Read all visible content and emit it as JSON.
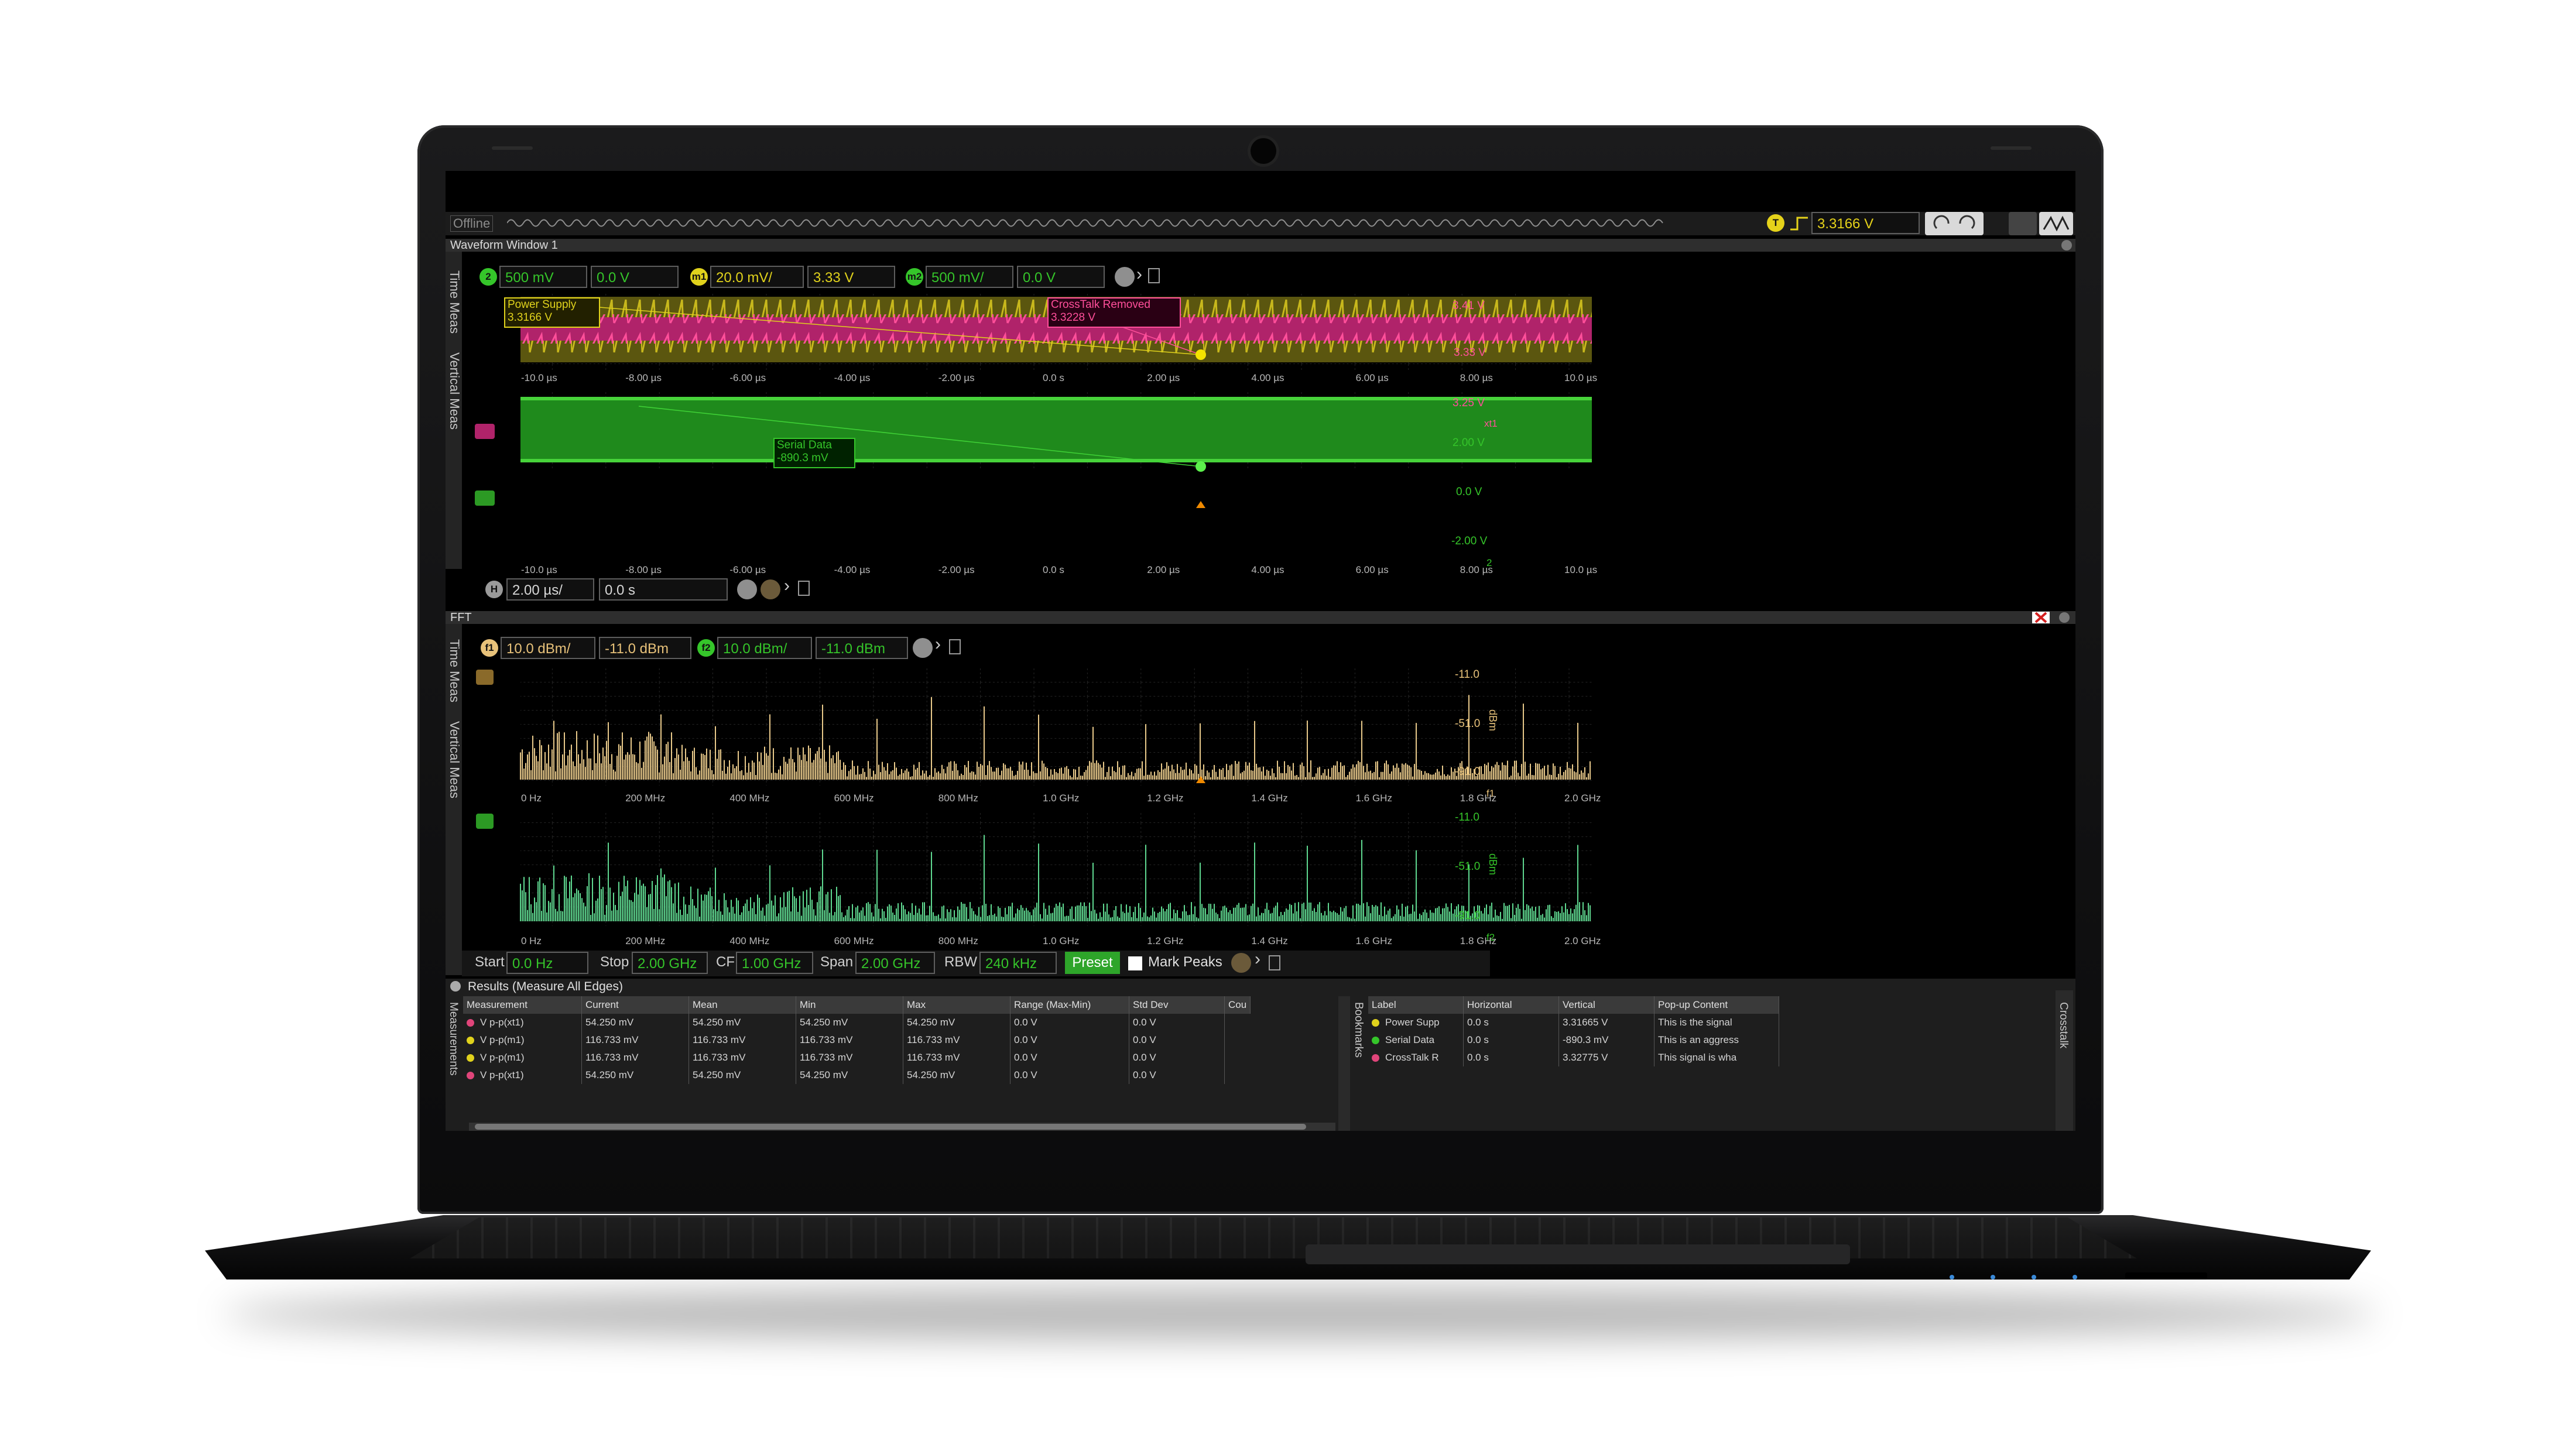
{
  "toolbar": {
    "offline_label": "Offline",
    "trigger_chip": "T",
    "trigger_level": "3.3166 V"
  },
  "waveform_window": {
    "title": "Waveform Window 1",
    "side_tab_time": "Time Meas",
    "side_tab_vertical": "Vertical Meas",
    "channels": [
      {
        "chip": "2",
        "scale": "500 mV",
        "offset": "0.0 V",
        "color": "#35c52a"
      },
      {
        "chip": "m1",
        "scale": "20.0 mV/",
        "offset": "3.33 V",
        "color": "#e0d21c"
      },
      {
        "chip": "m2",
        "scale": "500 mV/",
        "offset": "0.0 V",
        "color": "#35c52a"
      }
    ],
    "labels": {
      "power_supply_name": "Power Supply",
      "power_supply_value": "3.3166 V",
      "crosstalk_name": "CrossTalk Removed",
      "crosstalk_value": "3.3228 V",
      "serial_name": "Serial Data",
      "serial_value": "-890.3 mV"
    },
    "upper_right_ticks": [
      "3.41 V",
      "3.33 V",
      "3.25 V"
    ],
    "lower_right_ticks": [
      "2.00 V",
      "0.0 V",
      "-2.00 V"
    ],
    "upper_right_marker": "xt1",
    "lower_right_marker": "2",
    "time_ticks": [
      "-10.0 µs",
      "-8.00 µs",
      "-6.00 µs",
      "-4.00 µs",
      "-2.00 µs",
      "0.0 s",
      "2.00 µs",
      "4.00 µs",
      "6.00 µs",
      "8.00 µs",
      "10.0 µs"
    ],
    "timebase_chip": "H",
    "timebase": "2.00 µs/",
    "time_offset": "0.0 s"
  },
  "fft_window": {
    "title": "FFT",
    "side_tab_time": "Time Meas",
    "side_tab_vertical": "Vertical Meas",
    "channels": [
      {
        "chip": "f1",
        "scale": "10.0 dBm/",
        "offset": "-11.0 dBm",
        "color": "#e8c27a"
      },
      {
        "chip": "f2",
        "scale": "10.0 dBm/",
        "offset": "-11.0 dBm",
        "color": "#35c52a"
      }
    ],
    "right_ticks": [
      "-11.0",
      "-51.0",
      "-91.0"
    ],
    "unit": "dBm",
    "marker_f1": "f1",
    "marker_f2": "f2",
    "freq_ticks": [
      "0 Hz",
      "200 MHz",
      "400 MHz",
      "600 MHz",
      "800 MHz",
      "1.0 GHz",
      "1.2 GHz",
      "1.4 GHz",
      "1.6 GHz",
      "1.8 GHz",
      "2.0 GHz"
    ],
    "controls": {
      "start_label": "Start",
      "start_value": "0.0 Hz",
      "stop_label": "Stop",
      "stop_value": "2.00 GHz",
      "cf_label": "CF",
      "cf_value": "1.00 GHz",
      "span_label": "Span",
      "span_value": "2.00 GHz",
      "rbw_label": "RBW",
      "rbw_value": "240 kHz",
      "preset_label": "Preset",
      "mark_peaks_label": "Mark Peaks"
    }
  },
  "results": {
    "title": "Results (Measure All Edges)",
    "side_tab": "Measurements",
    "columns": [
      "Measurement",
      "Current",
      "Mean",
      "Min",
      "Max",
      "Range (Max-Min)",
      "Std Dev",
      "Cou"
    ],
    "rows": [
      {
        "color": "#e0457a",
        "cells": [
          "V p-p(xt1)",
          "54.250 mV",
          "54.250 mV",
          "54.250 mV",
          "54.250 mV",
          "0.0 V",
          "0.0 V"
        ]
      },
      {
        "color": "#e0d21c",
        "cells": [
          "V p-p(m1)",
          "116.733 mV",
          "116.733 mV",
          "116.733 mV",
          "116.733 mV",
          "0.0 V",
          "0.0 V"
        ]
      },
      {
        "color": "#e0d21c",
        "cells": [
          "V p-p(m1)",
          "116.733 mV",
          "116.733 mV",
          "116.733 mV",
          "116.733 mV",
          "0.0 V",
          "0.0 V"
        ]
      },
      {
        "color": "#e0457a",
        "cells": [
          "V p-p(xt1)",
          "54.250 mV",
          "54.250 mV",
          "54.250 mV",
          "54.250 mV",
          "0.0 V",
          "0.0 V"
        ]
      }
    ]
  },
  "bookmarks": {
    "side_tab": "Bookmarks",
    "right_tab": "Crosstalk",
    "columns": [
      "Label",
      "Horizontal",
      "Vertical",
      "Pop-up Content"
    ],
    "rows": [
      {
        "color": "#e0d21c",
        "cells": [
          "Power Supp",
          "0.0 s",
          "3.31665 V",
          "This is the signal"
        ]
      },
      {
        "color": "#35c52a",
        "cells": [
          "Serial Data",
          "0.0 s",
          "-890.3 mV",
          "This is an aggress"
        ]
      },
      {
        "color": "#e0457a",
        "cells": [
          "CrossTalk R",
          "0.0 s",
          "3.32775 V",
          "This signal is wha"
        ]
      }
    ]
  }
}
